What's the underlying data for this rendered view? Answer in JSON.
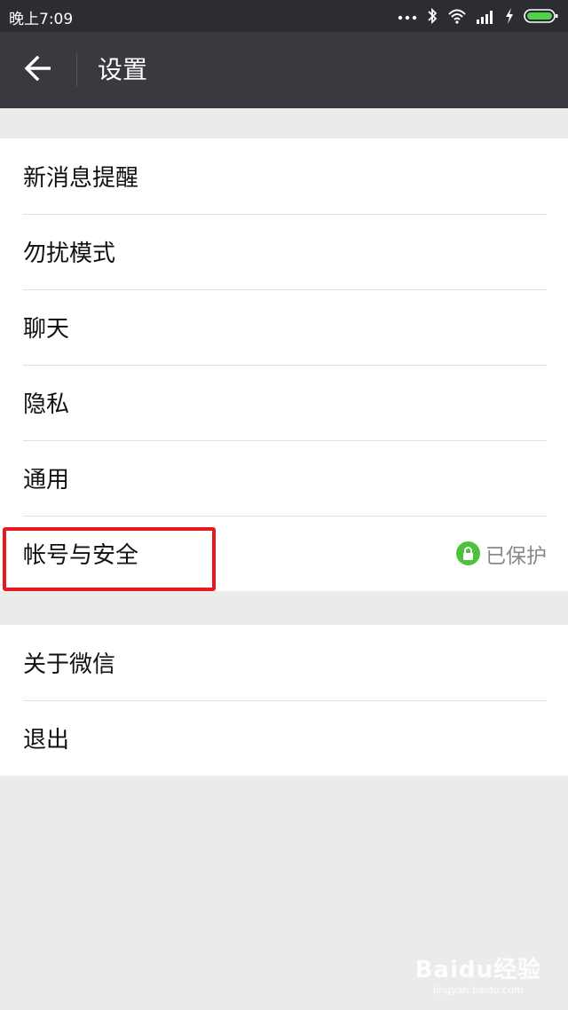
{
  "status_bar": {
    "time": "晚上7:09",
    "icons": [
      "more-dots-icon",
      "bluetooth-icon",
      "wifi-icon",
      "signal-icon",
      "charging-icon",
      "battery-icon"
    ]
  },
  "app_bar": {
    "title": "设置",
    "back_icon": "back-arrow-icon"
  },
  "groups": [
    {
      "items": [
        {
          "label": "新消息提醒"
        },
        {
          "label": "勿扰模式"
        },
        {
          "label": "聊天"
        },
        {
          "label": "隐私"
        },
        {
          "label": "通用"
        },
        {
          "label": "帐号与安全",
          "status": "已保护",
          "status_icon": "lock-icon",
          "highlighted": true
        }
      ]
    },
    {
      "items": [
        {
          "label": "关于微信"
        },
        {
          "label": "退出"
        }
      ]
    }
  ],
  "watermark": {
    "brand": "Baidu经验",
    "url": "jingyan.baidu.com"
  },
  "colors": {
    "status_bar": "#2b2d30",
    "app_bar": "#393a3f",
    "background": "#ebebeb",
    "lock_badge": "#4fc13e",
    "highlight": "#e8191c"
  }
}
